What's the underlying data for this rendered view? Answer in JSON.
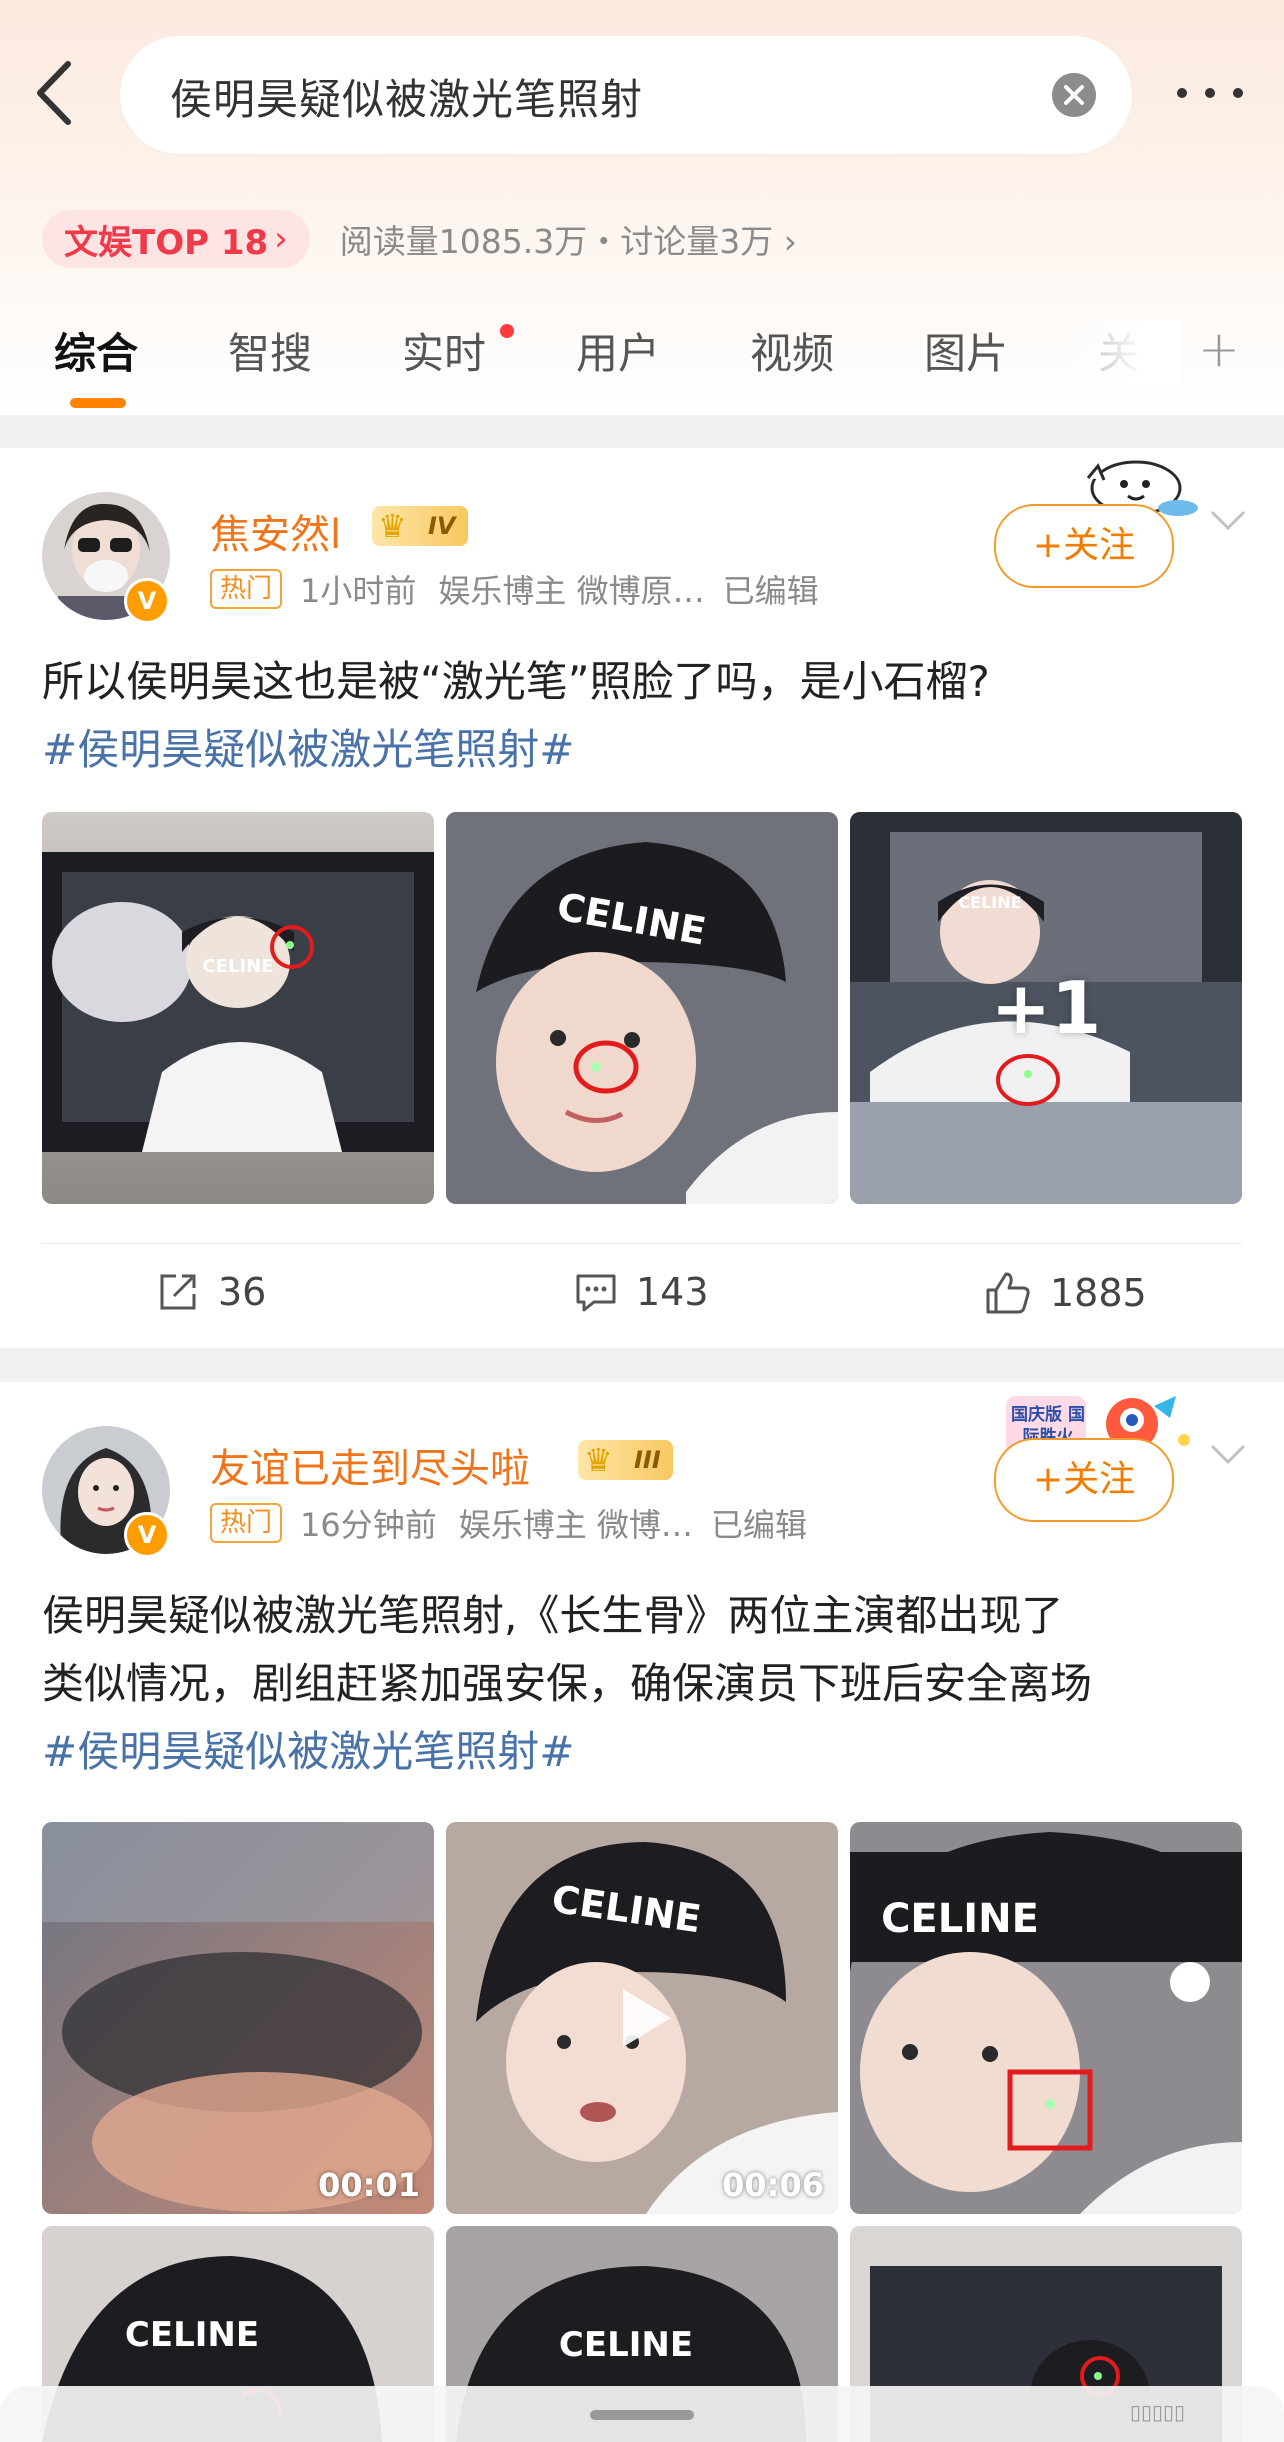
{
  "search": {
    "query": "侯明昊疑似被激光笔照射"
  },
  "topic": {
    "rank_label": "文娱TOP 18",
    "stats": "阅读量1085.3万・讨论量3万"
  },
  "tabs": [
    "综合",
    "智搜",
    "实时",
    "用户",
    "视频",
    "图片",
    "关"
  ],
  "colors": {
    "accent": "#ff8200",
    "username": "#f0751a",
    "hashtag": "#4872a8",
    "hot_badge": "#f38d1b"
  },
  "posts": [
    {
      "username": "焦安然l",
      "level": "IV",
      "badge": "热门",
      "time": "1小时前",
      "source": "娱乐博主 微博原…",
      "edited": "已编辑",
      "follow": "+关注",
      "text": "所以侯明昊这也是被“激光笔”照脸了吗，是小石榴?",
      "hashtag": "#侯明昊疑似被激光笔照射#",
      "more_images": "+1",
      "reposts": "36",
      "comments": "143",
      "likes": "1885"
    },
    {
      "username": "友谊已走到尽头啦",
      "level": "III",
      "badge": "热门",
      "time": "16分钟前",
      "source": "娱乐博主 微博…",
      "edited": "已编辑",
      "follow": "+关注",
      "text_line1": "侯明昊疑似被激光笔照射,《长生骨》两位主演都出现了",
      "text_line2": "类似情况，剧组赶紧加强安保，确保演员下班后安全离场",
      "hashtag": "#侯明昊疑似被激光笔照射#",
      "video1_duration": "00:01",
      "video2_duration": "00:06",
      "deco_caption": "国庆版 国际胜火"
    }
  ],
  "photo_text": "CELINE"
}
